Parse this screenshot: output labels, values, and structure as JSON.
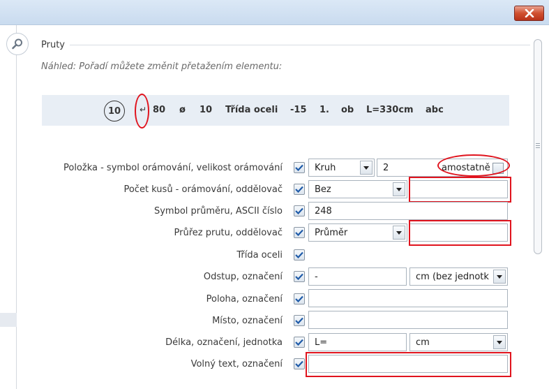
{
  "titlebar": {
    "close_icon": "close-x-icon"
  },
  "section": {
    "title": "Pruty",
    "hint": "Náhled: Pořadí můžete změnit přetažením elementu:"
  },
  "preview": {
    "circle": "10",
    "enter_icon": "↵",
    "items": [
      "80",
      "ø",
      "10",
      "Třída oceli",
      "-15",
      "1.",
      "ob",
      "L=330cm",
      "abc"
    ]
  },
  "rows": {
    "r1": {
      "label": "Položka - symbol orámování, velikost orámování",
      "combo": "Kruh",
      "value": "2",
      "inline_label": "amostatně"
    },
    "r2": {
      "label": "Počet kusů - orámování, oddělovač",
      "combo": "Bez",
      "value": ""
    },
    "r3": {
      "label": "Symbol průměru, ASCII číslo",
      "value": "248"
    },
    "r4": {
      "label": "Průřez prutu, oddělovač",
      "combo": "Průměr",
      "value": ""
    },
    "r5": {
      "label": "Třída oceli"
    },
    "r6": {
      "label": "Odstup, označení",
      "value": "-",
      "combo": "cm (bez jednotk"
    },
    "r7": {
      "label": "Poloha, označení",
      "value": ""
    },
    "r8": {
      "label": "Místo, označení",
      "value": ""
    },
    "r9": {
      "label": "Délka, označení, jednotka",
      "value": "L=",
      "combo": "cm"
    },
    "r10": {
      "label": "Volný text, označení",
      "value": ""
    }
  },
  "colors": {
    "highlight": "#e0141e",
    "check": "#1e5aa8",
    "preview_bg": "#e8eef5"
  }
}
